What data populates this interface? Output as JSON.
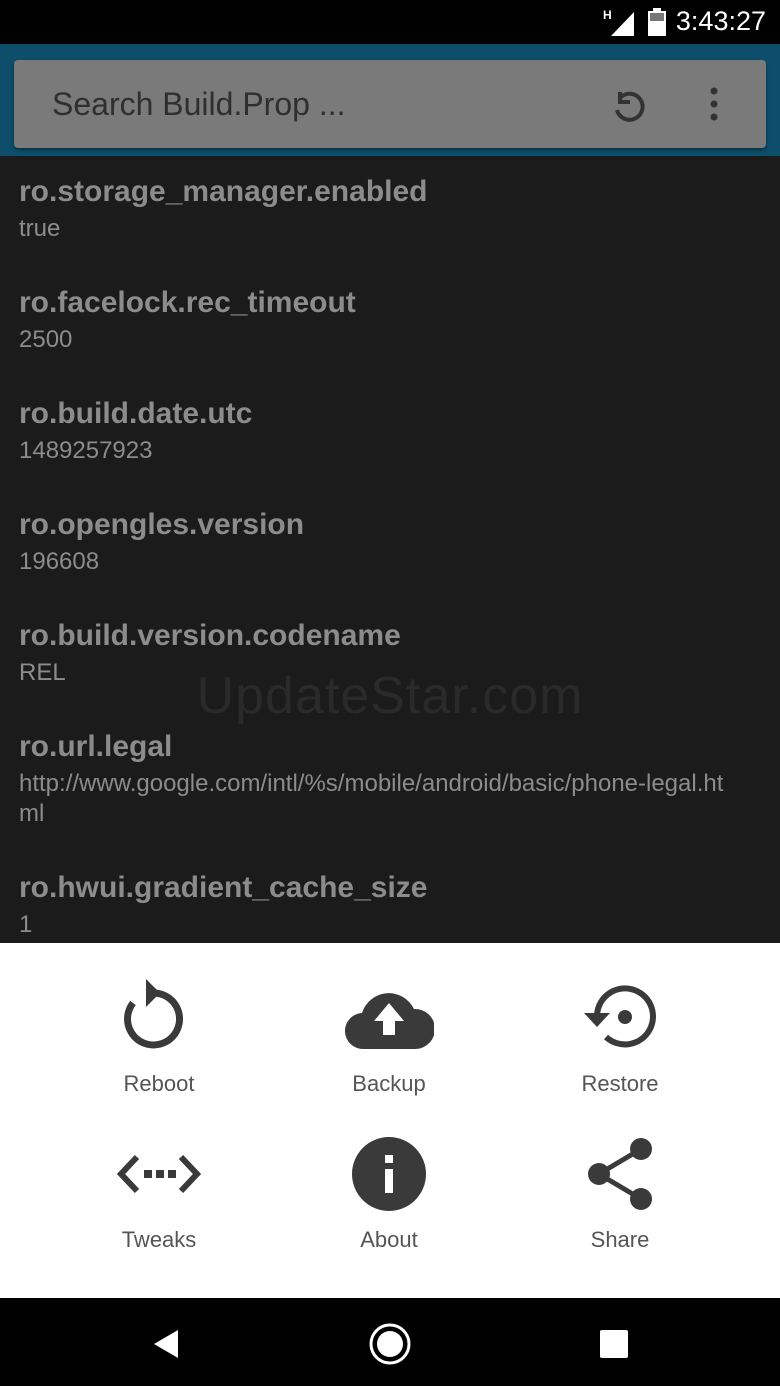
{
  "status_bar": {
    "time": "3:43:27",
    "network_label": "H"
  },
  "search": {
    "placeholder": "Search Build.Prop ..."
  },
  "properties": [
    {
      "key": "ro.storage_manager.enabled",
      "value": "true"
    },
    {
      "key": "ro.facelock.rec_timeout",
      "value": "2500"
    },
    {
      "key": "ro.build.date.utc",
      "value": "1489257923"
    },
    {
      "key": "ro.opengles.version",
      "value": "196608"
    },
    {
      "key": "ro.build.version.codename",
      "value": "REL"
    },
    {
      "key": "ro.url.legal",
      "value": "http://www.google.com/intl/%s/mobile/android/basic/phone-legal.html"
    },
    {
      "key": "ro.hwui.gradient_cache_size",
      "value": "1"
    }
  ],
  "watermark": "UpdateStar.com",
  "actions": {
    "reboot": "Reboot",
    "backup": "Backup",
    "restore": "Restore",
    "tweaks": "Tweaks",
    "about": "About",
    "share": "Share"
  },
  "icons": {
    "refresh": "refresh-icon",
    "more": "more-vert-icon",
    "reboot": "reboot-icon",
    "backup": "cloud-upload-icon",
    "restore": "restore-icon",
    "tweaks": "code-dots-icon",
    "about": "info-icon",
    "share": "share-icon",
    "back": "back-icon",
    "home": "home-icon",
    "recents": "recents-icon"
  },
  "colors": {
    "app_bar": "#0d4f6b",
    "list_bg": "#1b1b1b",
    "sheet_bg": "#ffffff",
    "icon_dark": "#3a3a3a"
  }
}
